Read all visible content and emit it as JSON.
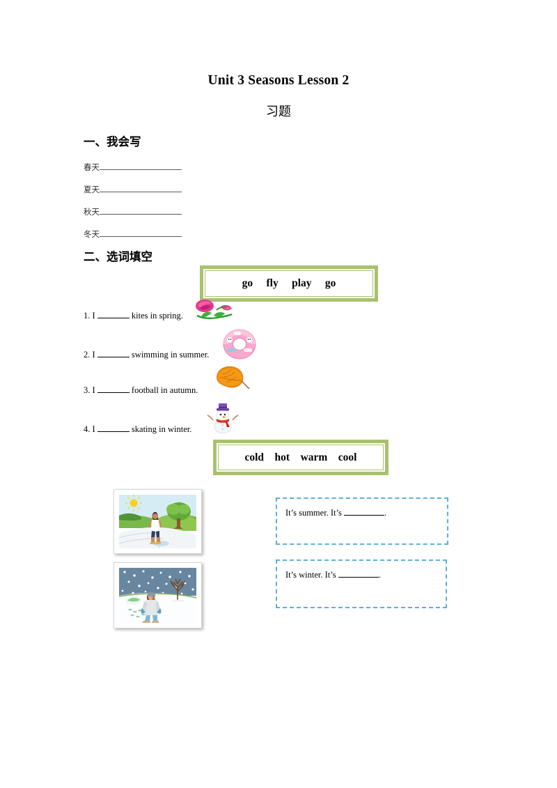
{
  "document": {
    "title": "Unit 3 Seasons Lesson 2",
    "subtitle": "习题"
  },
  "section1": {
    "heading": "一、我会写",
    "rows": [
      {
        "label": "春天",
        "value": ""
      },
      {
        "label": "夏天",
        "value": ""
      },
      {
        "label": "秋天",
        "value": ""
      },
      {
        "label": "冬天",
        "value": ""
      }
    ]
  },
  "section2": {
    "heading": "二、选词填空",
    "wordbank1": {
      "words": "go     fly     play     go",
      "options": [
        "go",
        "fly",
        "play",
        "go"
      ],
      "border_color": "#a9c16f"
    },
    "questions": [
      {
        "number": "1. I",
        "blank": "",
        "tail": "kites in spring.",
        "icon": "rose-flower-icon"
      },
      {
        "number": "2. I",
        "blank": "",
        "tail": "swimming in summer.",
        "icon": "swim-ring-icon"
      },
      {
        "number": "3. I",
        "blank": "",
        "tail": "football in autumn.",
        "icon": "autumn-leaf-icon"
      },
      {
        "number": "4. I",
        "blank": "",
        "tail": "skating in winter.",
        "icon": "snowman-icon"
      }
    ],
    "wordbank2": {
      "words": "cold    hot    warm    cool",
      "options": [
        "cold",
        "hot",
        "warm",
        "cool"
      ],
      "border_color": "#a9c16f"
    }
  },
  "section3": {
    "items": [
      {
        "photo": "summer-scene-photo",
        "photo_alt": "Girl walking on a sunny path with green trees and hills",
        "prefix": "It’s summer. It’s",
        "blank": "",
        "suffix": "."
      },
      {
        "photo": "winter-scene-photo",
        "photo_alt": "Girl walking through falling snow past a bare tree",
        "prefix": "It’s winter. It’s",
        "blank": "",
        "suffix": "."
      }
    ],
    "answerbox_border_color": "#5cafd8"
  }
}
